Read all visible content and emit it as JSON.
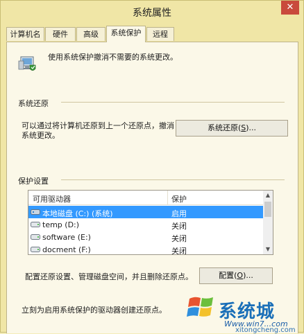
{
  "window": {
    "title": "系统属性",
    "close_glyph": "✕"
  },
  "tabs": [
    {
      "label": "计算机名",
      "active": false
    },
    {
      "label": "硬件",
      "active": false
    },
    {
      "label": "高级",
      "active": false
    },
    {
      "label": "系统保护",
      "active": true
    },
    {
      "label": "远程",
      "active": false
    }
  ],
  "intro": {
    "text": "使用系统保护撤消不需要的系统更改。",
    "icon": "computer-shield-icon"
  },
  "restore": {
    "section_title": "系统还原",
    "description_line1": "可以通过将计算机还原到上一个还原点，撤消",
    "description_line2": "系统更改。",
    "button_label": "系统还原(S)...",
    "button_text": "系统还原(",
    "button_key": "S",
    "button_suffix": ")..."
  },
  "protection": {
    "section_title": "保护设置",
    "columns": [
      "可用驱动器",
      "保护"
    ],
    "drives": [
      {
        "name": "本地磁盘 (C:) (系统)",
        "protection": "启用",
        "selected": true,
        "icon": "system-drive-icon"
      },
      {
        "name": "temp (D:)",
        "protection": "关闭",
        "selected": false,
        "icon": "drive-icon"
      },
      {
        "name": "software (E:)",
        "protection": "关闭",
        "selected": false,
        "icon": "drive-icon"
      },
      {
        "name": "docment (F:)",
        "protection": "关闭",
        "selected": false,
        "icon": "drive-icon"
      }
    ],
    "configure_text": "配置还原设置、管理磁盘空间，并且删除还原点。",
    "configure_button_text": "配置(",
    "configure_button_key": "O",
    "configure_button_suffix": ")...",
    "create_text": "立刻为启用系统保护的驱动器创建还原点。"
  },
  "watermark": {
    "brand": "系统城",
    "url": "Www.win7...com",
    "url2": "xitongcheng.com"
  },
  "colors": {
    "background": "#f0e6a6",
    "selection": "#3399ff",
    "close": "#c94a3c"
  }
}
